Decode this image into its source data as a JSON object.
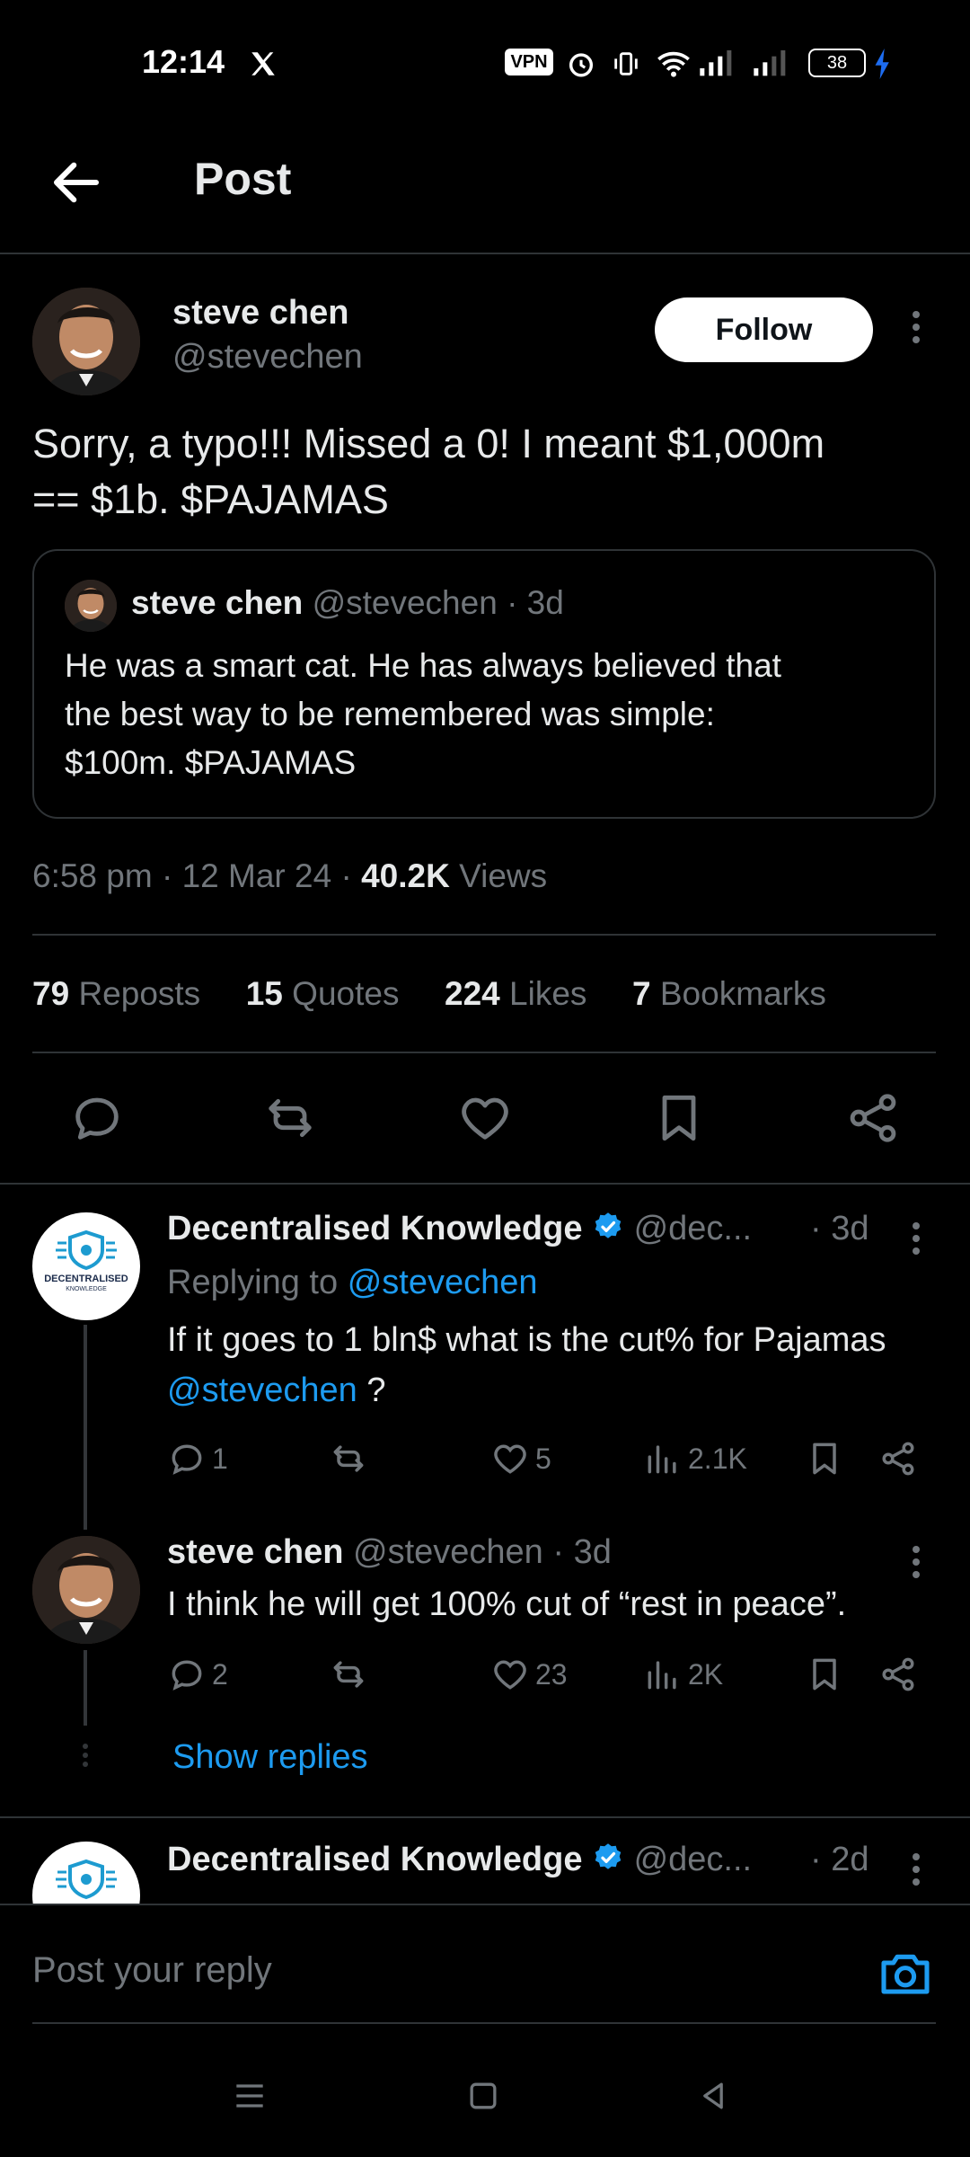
{
  "status_bar": {
    "time": "12:14",
    "battery": "38",
    "vpn": "VPN"
  },
  "header": {
    "title": "Post"
  },
  "post": {
    "author_name": "steve chen",
    "author_handle": "@stevechen",
    "follow_label": "Follow",
    "text_line1": "Sorry, a typo!!! Missed a 0!  I meant $1,000m",
    "text_line2": "== $1b.  $PAJAMAS",
    "quote": {
      "author_name": "steve chen",
      "author_handle": "@stevechen",
      "time": "· 3d",
      "line1": "He was a smart cat.  He has always believed that",
      "line2": "the best way to be remembered was simple:",
      "line3": "$100m. $PAJAMAS"
    },
    "meta": {
      "time": "6:58 pm",
      "date": "12 Mar 24",
      "views": "40.2K",
      "views_label": "Views",
      "sep": "·"
    },
    "stats": {
      "reposts": "79",
      "reposts_label": "Reposts",
      "quotes": "15",
      "quotes_label": "Quotes",
      "likes": "224",
      "likes_label": "Likes",
      "bookmarks": "7",
      "bookmarks_label": "Bookmarks"
    }
  },
  "replies": [
    {
      "name": "Decentralised Knowledge",
      "handle": "@dec...",
      "time": "· 3d",
      "replying_to_label": "Replying to",
      "replying_to": "@stevechen",
      "text_line1": "If it goes to 1 bln$ what is the cut% for Pajamas",
      "mention": "@stevechen",
      "text_tail": "?",
      "comments": "1",
      "likes": "5",
      "views": "2.1K",
      "avatar_text": "DECENTRALISED",
      "avatar_subtext": "KNOWLEDGE"
    },
    {
      "name": "steve chen",
      "handle": "@stevechen",
      "time": "· 3d",
      "text_line1": "I think he will get 100% cut of “rest in peace”.",
      "comments": "2",
      "likes": "23",
      "views": "2K",
      "show_replies": "Show replies"
    },
    {
      "name": "Decentralised Knowledge",
      "handle": "@dec...",
      "time": "· 2d"
    }
  ],
  "compose": {
    "placeholder": "Post your reply"
  },
  "colors": {
    "accent": "#1d9bf0",
    "muted": "#71767b",
    "divider": "#2f3336",
    "text": "#e7e9ea"
  }
}
